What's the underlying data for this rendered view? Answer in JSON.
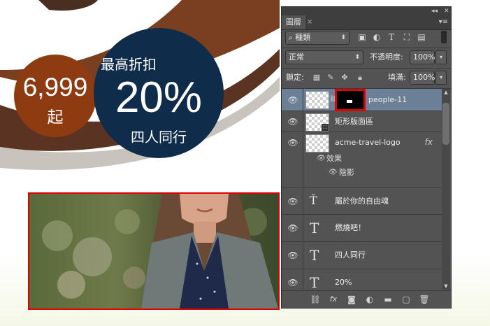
{
  "canvas": {
    "price_value": "6,999",
    "price_suffix": "起",
    "discount_title": "最高折扣",
    "discount_value": "20%",
    "discount_note": "四人同行",
    "colors": {
      "price_circle": "#8f3b12",
      "discount_circle": "#0f2c4b",
      "ribbon": "#6e3a1f",
      "photo_border": "#e00000"
    }
  },
  "panel": {
    "tab_label": "圖層",
    "filter": {
      "search_icon": "search-icon",
      "value": "種類"
    },
    "blend_mode": "正常",
    "opacity_label": "不透明度:",
    "opacity_value": "100%",
    "lock_label": "鎖定:",
    "fill_label": "填滿:",
    "fill_value": "100%",
    "layers": [
      {
        "name": "people-11",
        "type": "smart-object-with-mask",
        "selected": true,
        "visible": true
      },
      {
        "name": "矩形版面區",
        "type": "shape",
        "selected": false,
        "visible": true
      },
      {
        "name": "acme-travel-logo",
        "type": "image",
        "selected": false,
        "visible": true,
        "fx": "fx",
        "effects_label": "效果",
        "effects": [
          "陰影"
        ]
      },
      {
        "name": "屬於你的自由魂",
        "type": "text-warp",
        "selected": false,
        "visible": true
      },
      {
        "name": "燃燒吧！",
        "type": "text",
        "selected": false,
        "visible": true
      },
      {
        "name": "四人同行",
        "type": "text",
        "selected": false,
        "visible": true
      },
      {
        "name": "20%",
        "type": "text",
        "selected": false,
        "visible": true
      }
    ],
    "bottom_fx": "fx"
  }
}
